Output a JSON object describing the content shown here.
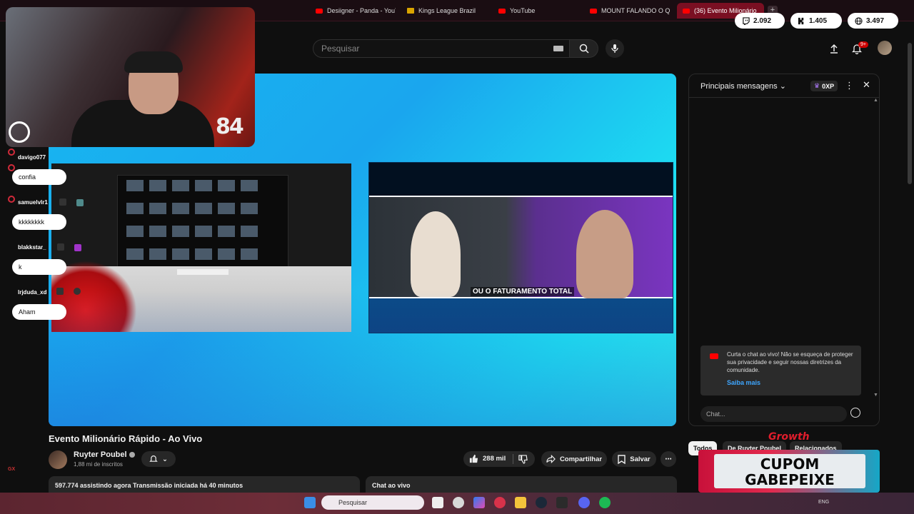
{
  "browser": {
    "tabs": [
      {
        "label": "Desiigner - Panda - YouTu",
        "icon": "youtube-icon"
      },
      {
        "label": "Kings League Brazil",
        "icon": "crown-icon"
      },
      {
        "label": "YouTube",
        "icon": "youtube-icon"
      },
      {
        "label": "MOUNT FALANDO O QU",
        "icon": "youtube-icon"
      },
      {
        "label": "(36) Evento Milionário",
        "icon": "youtube-icon",
        "active": true
      }
    ],
    "new_tab": "+"
  },
  "stats": [
    {
      "icon": "twitch-icon",
      "value": "2.092"
    },
    {
      "icon": "kick-icon",
      "value": "1.405"
    },
    {
      "icon": "globe-icon",
      "value": "3.497"
    }
  ],
  "header": {
    "search_placeholder": "Pesquisar",
    "notif_badge": "9+"
  },
  "webcam": {
    "counter": "84"
  },
  "overlay_chat": [
    {
      "user": "davigo077",
      "message": "confia"
    },
    {
      "user": "samuelvlr1",
      "message": "kkkkkkkk"
    },
    {
      "user": "blakkstar_",
      "message": "k"
    },
    {
      "user": "lrjduda_xd",
      "message": "Aham"
    }
  ],
  "player": {
    "caption": "OU O FATURAMENTO TOTAL"
  },
  "video": {
    "title": "Evento Milionário Rápido - Ao Vivo",
    "channel": "Ruyter Poubel",
    "subscribers": "1,88 mi de inscritos",
    "likes": "288 mil",
    "share": "Compartilhar",
    "save": "Salvar",
    "stats": "597.774 assistindo agora  Transmissão iniciada há 40 minutos",
    "chat_replay": "Chat ao vivo"
  },
  "chat": {
    "title": "Principais mensagens",
    "xp": "0XP",
    "notice": "Curta o chat ao vivo! Não se esqueça de proteger sua privacidade e seguir nossas diretrizes da comunidade.",
    "notice_link": "Saiba mais",
    "placeholder": "Chat..."
  },
  "chips": [
    "Todos",
    "De Ruyter Poubel",
    "Relacionados"
  ],
  "ad": {
    "brand": "Growth",
    "line1": "CUPOM",
    "line2": "GABEPEIXE"
  },
  "taskbar": {
    "search": "Pesquisar",
    "lang": "ENG"
  },
  "side_label": "GX",
  "colors": {
    "accent": "#ff0000",
    "link": "#3ea6ff",
    "background": "#0f0f0f"
  }
}
